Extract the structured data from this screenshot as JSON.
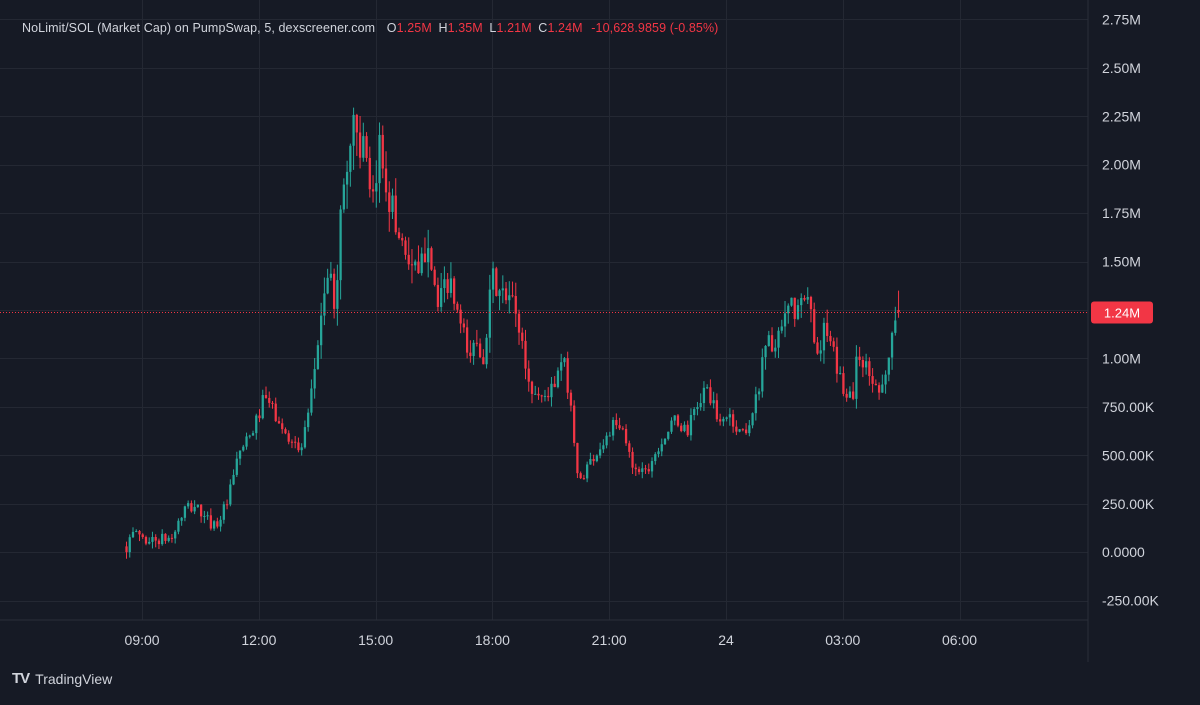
{
  "header": {
    "symbol": "NoLimit/SOL (Market Cap) on PumpSwap, 5, dexscreener.com",
    "open_label": "O",
    "open": "1.25M",
    "high_label": "H",
    "high": "1.35M",
    "low_label": "L",
    "low": "1.21M",
    "close_label": "C",
    "close": "1.24M",
    "change": "-10,628.9859 (-0.85%)"
  },
  "price_tag": "1.24M",
  "brand": {
    "logo": "TV",
    "name": "TradingView"
  },
  "colors": {
    "up": "#26a69a",
    "down": "#f23645",
    "background": "#161a25",
    "grid": "#242833",
    "axis_text": "#d1d4dc",
    "price_tag": "#f23645"
  },
  "chart_data": {
    "type": "candlestick",
    "title": "NoLimit/SOL (Market Cap) on PumpSwap, 5, dexscreener.com",
    "y_unit": "market cap (SOL)",
    "ylim": [
      -350000,
      2850000
    ],
    "y_ticks": [
      {
        "value": 2750000,
        "label": "2.75M"
      },
      {
        "value": 2500000,
        "label": "2.50M"
      },
      {
        "value": 2250000,
        "label": "2.25M"
      },
      {
        "value": 2000000,
        "label": "2.00M"
      },
      {
        "value": 1750000,
        "label": "1.75M"
      },
      {
        "value": 1500000,
        "label": "1.50M"
      },
      {
        "value": 1000000,
        "label": "1.00M"
      },
      {
        "value": 750000,
        "label": "750.00K"
      },
      {
        "value": 500000,
        "label": "500.00K"
      },
      {
        "value": 250000,
        "label": "250.00K"
      },
      {
        "value": 0,
        "label": "0.0000"
      },
      {
        "value": -250000,
        "label": "-250.00K"
      }
    ],
    "x_ticks": [
      {
        "hours": 9,
        "label": "09:00"
      },
      {
        "hours": 12,
        "label": "12:00"
      },
      {
        "hours": 15,
        "label": "15:00"
      },
      {
        "hours": 18,
        "label": "18:00"
      },
      {
        "hours": 21,
        "label": "21:00"
      },
      {
        "hours": 24,
        "label": "24"
      },
      {
        "hours": 27,
        "label": "03:00"
      },
      {
        "hours": 30,
        "label": "06:00"
      }
    ],
    "xlim_hours": [
      5.35,
      33.3
    ],
    "interval_minutes": 5,
    "last_price": 1240000,
    "ohlc_summary": {
      "open": 1250000,
      "high": 1350000,
      "low": 1210000,
      "close": 1240000
    },
    "price_path": [
      [
        8.6,
        30000
      ],
      [
        8.85,
        110000
      ],
      [
        9.1,
        60000
      ],
      [
        9.5,
        65000
      ],
      [
        9.75,
        70000
      ],
      [
        10.1,
        220000
      ],
      [
        10.4,
        240000
      ],
      [
        10.6,
        170000
      ],
      [
        10.9,
        140000
      ],
      [
        11.2,
        260000
      ],
      [
        11.5,
        520000
      ],
      [
        11.8,
        600000
      ],
      [
        12.15,
        800000
      ],
      [
        12.4,
        720000
      ],
      [
        12.6,
        620000
      ],
      [
        12.9,
        580000
      ],
      [
        13.05,
        500000
      ],
      [
        13.3,
        720000
      ],
      [
        13.55,
        1150000
      ],
      [
        13.75,
        1450000
      ],
      [
        13.95,
        1280000
      ],
      [
        14.15,
        1850000
      ],
      [
        14.45,
        2250000
      ],
      [
        14.75,
        2000000
      ],
      [
        14.9,
        1700000
      ],
      [
        15.1,
        2100000
      ],
      [
        15.5,
        1700000
      ],
      [
        15.8,
        1550000
      ],
      [
        16.1,
        1400000
      ],
      [
        16.35,
        1650000
      ],
      [
        16.6,
        1250000
      ],
      [
        16.85,
        1400000
      ],
      [
        17.0,
        1300000
      ],
      [
        17.2,
        1150000
      ],
      [
        17.4,
        1000000
      ],
      [
        17.6,
        1100000
      ],
      [
        17.75,
        1000000
      ],
      [
        18.0,
        1400000
      ],
      [
        18.3,
        1300000
      ],
      [
        18.5,
        1300000
      ],
      [
        18.7,
        1150000
      ],
      [
        18.95,
        850000
      ],
      [
        19.25,
        800000
      ],
      [
        19.6,
        850000
      ],
      [
        19.8,
        1000000
      ],
      [
        20.0,
        800000
      ],
      [
        20.2,
        350000
      ],
      [
        20.45,
        450000
      ],
      [
        20.8,
        550000
      ],
      [
        21.1,
        650000
      ],
      [
        21.35,
        620000
      ],
      [
        21.6,
        450000
      ],
      [
        21.95,
        420000
      ],
      [
        22.3,
        560000
      ],
      [
        22.7,
        680000
      ],
      [
        23.0,
        620000
      ],
      [
        23.3,
        780000
      ],
      [
        23.55,
        850000
      ],
      [
        23.8,
        650000
      ],
      [
        24.05,
        720000
      ],
      [
        24.3,
        620000
      ],
      [
        24.55,
        640000
      ],
      [
        24.8,
        800000
      ],
      [
        25.0,
        1100000
      ],
      [
        25.3,
        1050000
      ],
      [
        25.6,
        1250000
      ],
      [
        25.85,
        1250000
      ],
      [
        26.1,
        1300000
      ],
      [
        26.35,
        1050000
      ],
      [
        26.55,
        1150000
      ],
      [
        26.85,
        950000
      ],
      [
        27.0,
        850000
      ],
      [
        27.25,
        800000
      ],
      [
        27.4,
        1050000
      ],
      [
        27.65,
        920000
      ],
      [
        27.9,
        850000
      ],
      [
        28.15,
        950000
      ],
      [
        28.35,
        1230000
      ],
      [
        28.5,
        1240000
      ]
    ]
  }
}
